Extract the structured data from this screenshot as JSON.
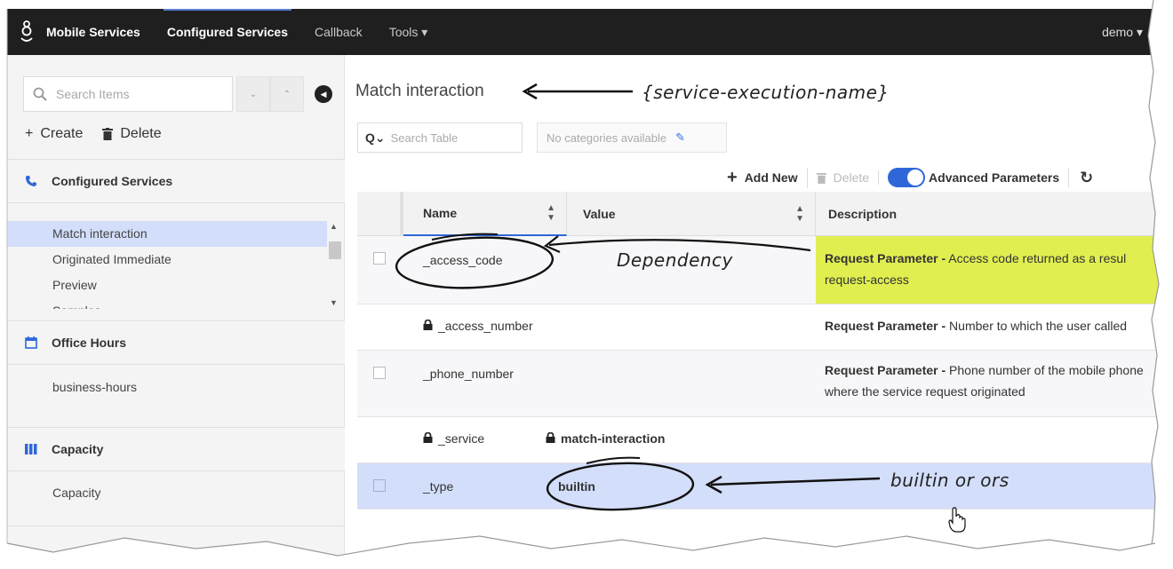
{
  "navbar": {
    "brand": "Mobile Services",
    "items": [
      "Configured Services",
      "Callback",
      "Tools ▾"
    ],
    "active_index": 0,
    "user": "demo ▾"
  },
  "sidebar": {
    "search_placeholder": "Search Items",
    "create_label": "Create",
    "delete_label": "Delete",
    "sections": [
      {
        "title": "Configured Services",
        "icon": "phone-icon",
        "items": [
          "Match interaction",
          "Originated Immediate",
          "Preview",
          "Samples"
        ],
        "selected": 0
      },
      {
        "title": "Office Hours",
        "icon": "calendar-icon",
        "items": [
          "business-hours"
        ]
      },
      {
        "title": "Capacity",
        "icon": "bars-icon",
        "items": [
          "Capacity"
        ]
      }
    ]
  },
  "main": {
    "title": "Match interaction",
    "search_placeholder": "Search Table",
    "categories_text": "No categories available",
    "toolbar": {
      "add_label": "Add New",
      "delete_label": "Delete",
      "advanced_label": "Advanced Parameters",
      "advanced_on": true
    },
    "columns": [
      "Name",
      "Value",
      "Description"
    ],
    "rows": [
      {
        "name": "_access_code",
        "locked": false,
        "value": "",
        "desc_bold": "Request Parameter -",
        "desc": " Access code returned as a resul",
        "desc2": "request-access",
        "highlight": true
      },
      {
        "name": "_access_number",
        "locked": true,
        "value": "",
        "desc_bold": "Request Parameter -",
        "desc": " Number to which the user called",
        "desc2": ""
      },
      {
        "name": "_phone_number",
        "locked": false,
        "value": "",
        "desc_bold": "Request Parameter -",
        "desc": " Phone number of the mobile phone",
        "desc2": "where the service request originated"
      },
      {
        "name": "_service",
        "locked": true,
        "value": "match-interaction",
        "value_locked": true,
        "desc_bold": "",
        "desc": "",
        "desc2": ""
      },
      {
        "name": "_type",
        "locked": false,
        "value": "builtin",
        "desc_bold": "",
        "desc": "",
        "desc2": "",
        "selected": true
      }
    ]
  },
  "annotations": {
    "service_name": "{service-execution-name}",
    "dependency": "Dependency",
    "builtin": "builtin or ors"
  }
}
